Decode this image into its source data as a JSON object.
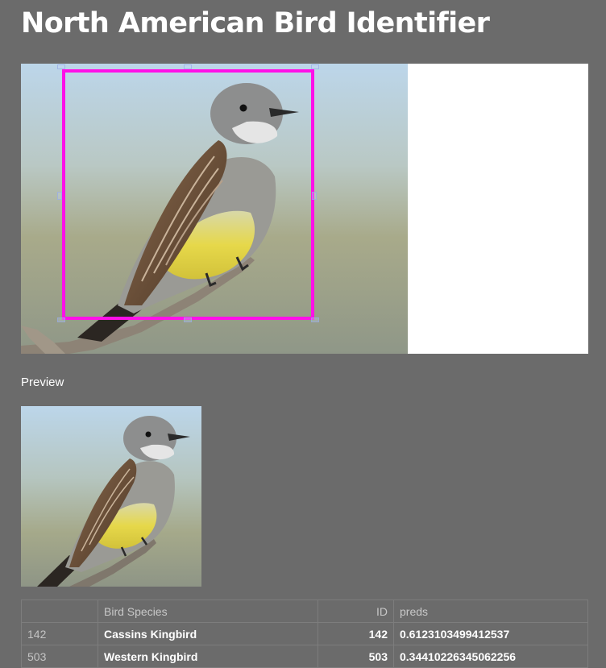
{
  "app": {
    "title": "North American Bird Identifier"
  },
  "preview": {
    "label": "Preview"
  },
  "results_table": {
    "columns": [
      "",
      "Bird Species",
      "ID",
      "preds"
    ],
    "rows": [
      {
        "index": "142",
        "species": "Cassins Kingbird",
        "id": "142",
        "pred": "0.6123103499412537"
      },
      {
        "index": "503",
        "species": "Western Kingbird",
        "id": "503",
        "pred": "0.34410226345062256"
      }
    ]
  },
  "colors": {
    "background": "#6b6b6b",
    "crop_border": "#ff10e8",
    "canvas": "#ffffff"
  }
}
